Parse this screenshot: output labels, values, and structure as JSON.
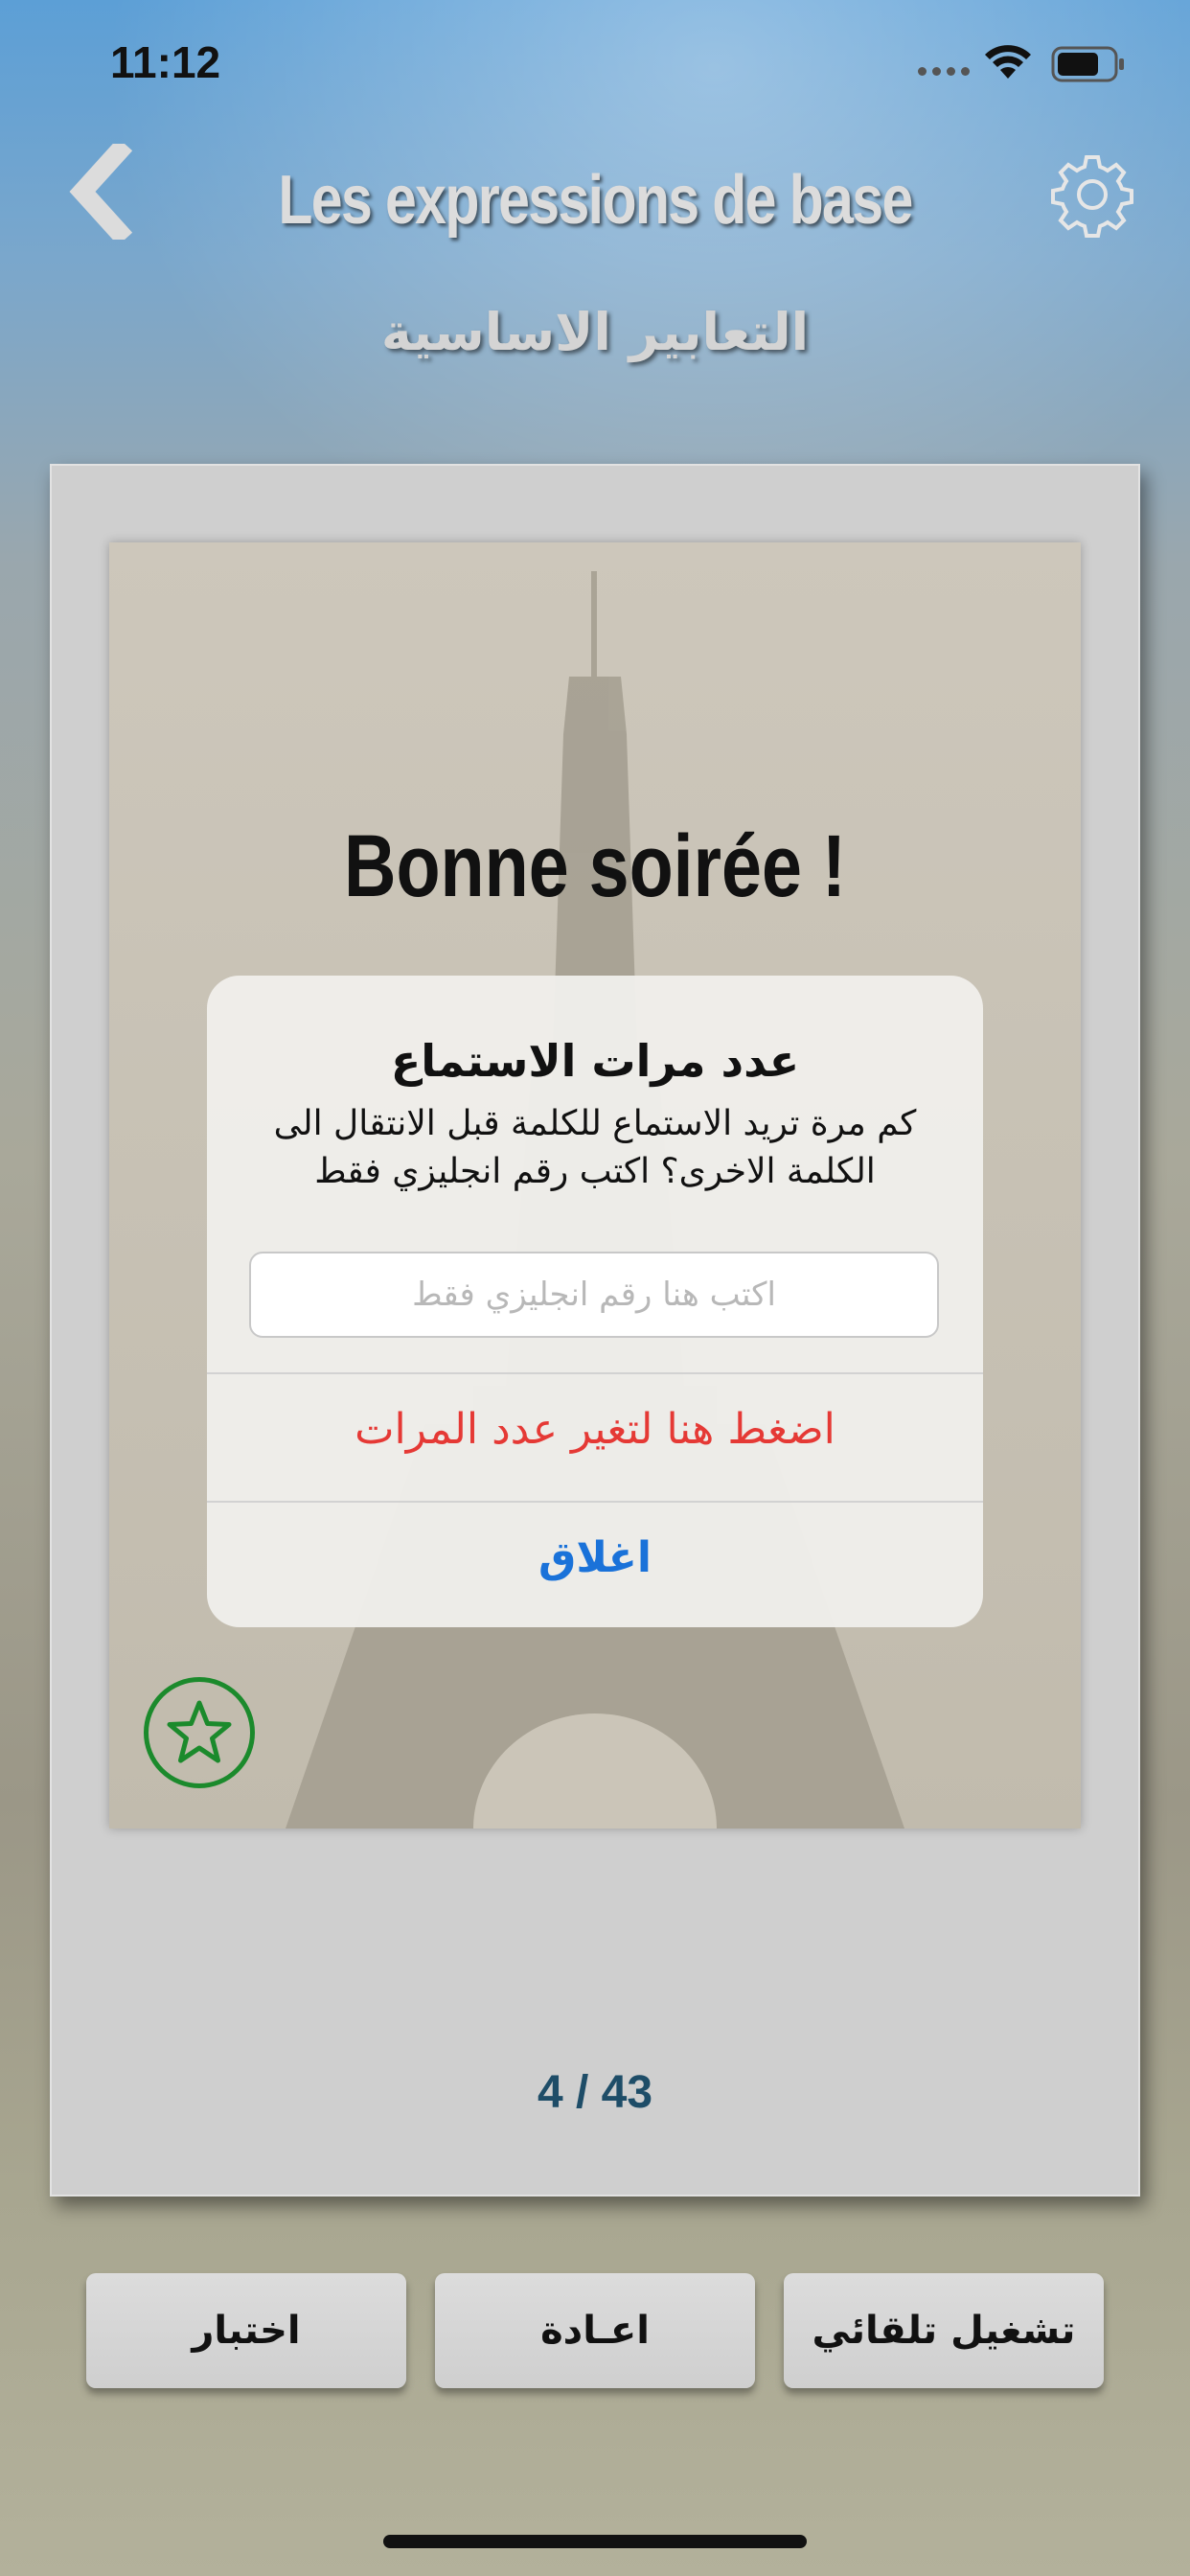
{
  "status_bar": {
    "time": "11:12"
  },
  "header": {
    "title_fr": "Les expressions de base",
    "title_ar": "التعابير الاساسية"
  },
  "card": {
    "phrase": "Bonne soirée !",
    "counter": "4 / 43"
  },
  "dialog": {
    "title": "عدد مرات الاستماع",
    "message": "كم مرة تريد الاستماع للكلمة قبل الانتقال الى الكلمة الاخرى؟ اكتب رقم انجليزي فقط",
    "input_placeholder": "اكتب هنا رقم انجليزي فقط",
    "input_value": "",
    "change_button": "اضغط هنا لتغير عدد المرات",
    "close_button": "اغلاق"
  },
  "bottom_buttons": {
    "test": "اختبار",
    "repeat": "اعـادة",
    "autoplay": "تشغيل تلقائي"
  },
  "colors": {
    "destructive": "#e53935",
    "link": "#1a72d9",
    "star": "#1b8a2c",
    "counter": "#1e4d68"
  },
  "icons": [
    "back-chevron-icon",
    "gear-icon",
    "star-icon",
    "wifi-icon",
    "battery-icon",
    "signal-icon"
  ]
}
